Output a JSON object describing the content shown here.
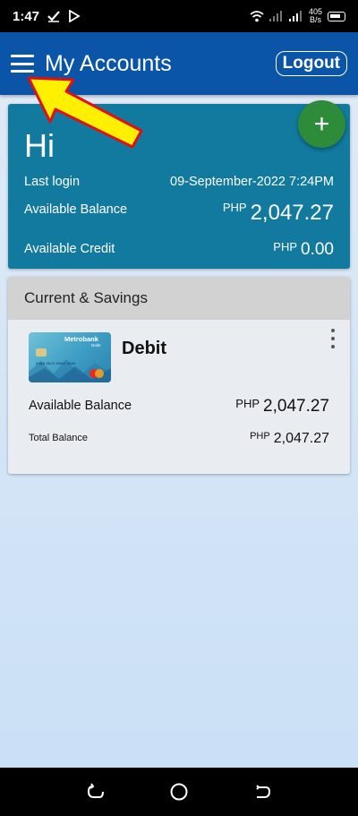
{
  "status_bar": {
    "time": "1:47",
    "net_speed_value": "405",
    "net_speed_unit": "B/s"
  },
  "app_bar": {
    "title": "My Accounts",
    "logout_label": "Logout",
    "color": "#0b55a8"
  },
  "summary": {
    "greeting": "Hi",
    "last_login_label": "Last login",
    "last_login_value": "09-September-2022 7:24PM",
    "available_balance_label": "Available Balance",
    "available_balance_currency": "PHP",
    "available_balance_value": "2,047.27",
    "available_credit_label": "Available Credit",
    "available_credit_currency": "PHP",
    "available_credit_value": "0.00",
    "color": "#117a9e"
  },
  "fab": {
    "label": "+",
    "color": "#2d8b3a"
  },
  "accounts": {
    "section_title": "Current & Savings",
    "items": [
      {
        "card_brand": "Metrobank",
        "card_subtitle": "Debit",
        "card_number": "5388 6623 6852 3360",
        "name": "Debit",
        "available_balance_label": "Available Balance",
        "available_balance_currency": "PHP",
        "available_balance_value": "2,047.27",
        "total_balance_label": "Total Balance",
        "total_balance_currency": "PHP",
        "total_balance_value": "2,047.27"
      }
    ]
  },
  "icons": {
    "menu": "hamburger-icon",
    "add": "plus-icon",
    "more": "kebab-menu-icon",
    "pointer": "yellow-arrow-annotation",
    "nav_recent": "recent-apps-icon",
    "nav_home": "home-icon",
    "nav_back": "back-icon"
  }
}
